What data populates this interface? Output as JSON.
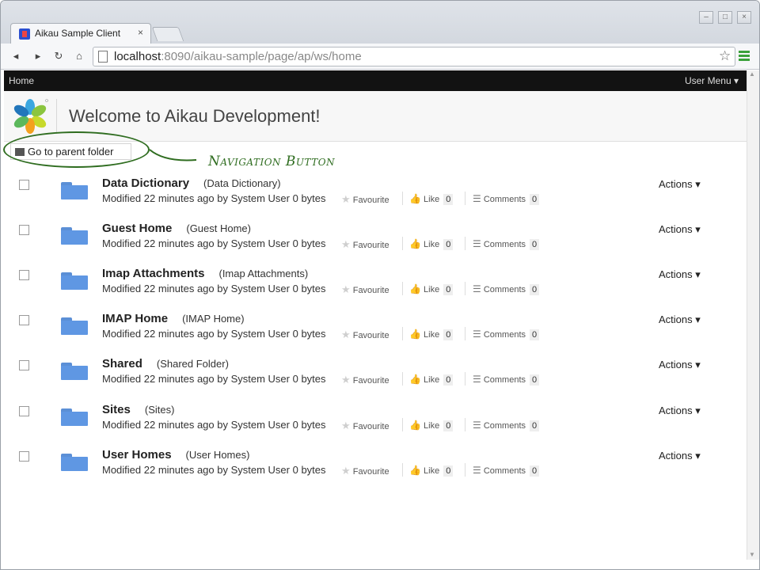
{
  "browser": {
    "tab_title": "Aikau Sample Client",
    "tab_close": "×",
    "url_host": "localhost",
    "url_rest": ":8090/aikau-sample/page/ap/ws/home",
    "back": "◂",
    "forward": "▸",
    "reload": "↻",
    "home": "⌂",
    "star": "☆",
    "win_min": "–",
    "win_max": "□",
    "win_close": "×"
  },
  "app": {
    "home_label": "Home",
    "user_menu_label": "User Menu ▾",
    "page_title": "Welcome to Aikau Development!"
  },
  "parent_button": {
    "label": "Go to parent folder"
  },
  "annotation": {
    "text": "Navigation Button"
  },
  "rows": [
    {
      "name": "Data Dictionary",
      "subname": "(Data Dictionary)",
      "meta": "Modified 22 minutes ago by System User 0 bytes",
      "favourite": "Favourite",
      "like": "Like",
      "like_count": "0",
      "comments": "Comments",
      "comment_count": "0",
      "actions": "Actions ▾"
    },
    {
      "name": "Guest Home",
      "subname": "(Guest Home)",
      "meta": "Modified 22 minutes ago by System User 0 bytes",
      "favourite": "Favourite",
      "like": "Like",
      "like_count": "0",
      "comments": "Comments",
      "comment_count": "0",
      "actions": "Actions ▾"
    },
    {
      "name": "Imap Attachments",
      "subname": "(Imap Attachments)",
      "meta": "Modified 22 minutes ago by System User 0 bytes",
      "favourite": "Favourite",
      "like": "Like",
      "like_count": "0",
      "comments": "Comments",
      "comment_count": "0",
      "actions": "Actions ▾"
    },
    {
      "name": "IMAP Home",
      "subname": "(IMAP Home)",
      "meta": "Modified 22 minutes ago by System User 0 bytes",
      "favourite": "Favourite",
      "like": "Like",
      "like_count": "0",
      "comments": "Comments",
      "comment_count": "0",
      "actions": "Actions ▾"
    },
    {
      "name": "Shared",
      "subname": "(Shared Folder)",
      "meta": "Modified 22 minutes ago by System User 0 bytes",
      "favourite": "Favourite",
      "like": "Like",
      "like_count": "0",
      "comments": "Comments",
      "comment_count": "0",
      "actions": "Actions ▾"
    },
    {
      "name": "Sites",
      "subname": "(Sites)",
      "meta": "Modified 22 minutes ago by System User 0 bytes",
      "favourite": "Favourite",
      "like": "Like",
      "like_count": "0",
      "comments": "Comments",
      "comment_count": "0",
      "actions": "Actions ▾"
    },
    {
      "name": "User Homes",
      "subname": "(User Homes)",
      "meta": "Modified 22 minutes ago by System User 0 bytes",
      "favourite": "Favourite",
      "like": "Like",
      "like_count": "0",
      "comments": "Comments",
      "comment_count": "0",
      "actions": "Actions ▾"
    }
  ],
  "colors": {
    "folder": "#5f97e3",
    "appbar": "#121212",
    "annotation": "#2f6d20"
  }
}
